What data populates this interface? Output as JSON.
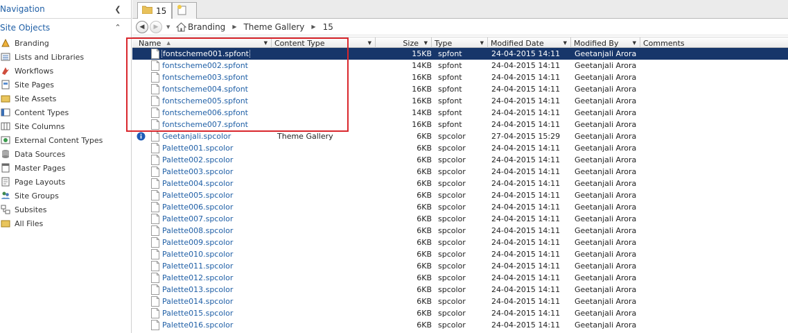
{
  "navigation": {
    "title": "Navigation",
    "site_objects_title": "Site Objects",
    "items": [
      {
        "label": "Branding",
        "icon": "branding-icon"
      },
      {
        "label": "Lists and Libraries",
        "icon": "lists-icon"
      },
      {
        "label": "Workflows",
        "icon": "workflows-icon"
      },
      {
        "label": "Site Pages",
        "icon": "site-pages-icon"
      },
      {
        "label": "Site Assets",
        "icon": "site-assets-icon"
      },
      {
        "label": "Content Types",
        "icon": "content-types-icon"
      },
      {
        "label": "Site Columns",
        "icon": "site-columns-icon"
      },
      {
        "label": "External Content Types",
        "icon": "external-content-types-icon"
      },
      {
        "label": "Data Sources",
        "icon": "data-sources-icon"
      },
      {
        "label": "Master Pages",
        "icon": "master-pages-icon"
      },
      {
        "label": "Page Layouts",
        "icon": "page-layouts-icon"
      },
      {
        "label": "Site Groups",
        "icon": "site-groups-icon"
      },
      {
        "label": "Subsites",
        "icon": "subsites-icon"
      },
      {
        "label": "All Files",
        "icon": "all-files-icon"
      }
    ]
  },
  "tabs": {
    "active_label": "15"
  },
  "breadcrumb": [
    "Branding",
    "Theme Gallery",
    "15"
  ],
  "columns": {
    "name": "Name",
    "content_type": "Content Type",
    "size": "Size",
    "type": "Type",
    "modified_date": "Modified Date",
    "modified_by": "Modified By",
    "comments": "Comments"
  },
  "files": [
    {
      "name": "fontscheme001.spfont",
      "content_type": "",
      "size": "15KB",
      "type": "spfont",
      "modified_date": "24-04-2015 14:11",
      "modified_by": "Geetanjali Arora",
      "selected": true
    },
    {
      "name": "fontscheme002.spfont",
      "content_type": "",
      "size": "14KB",
      "type": "spfont",
      "modified_date": "24-04-2015 14:11",
      "modified_by": "Geetanjali Arora"
    },
    {
      "name": "fontscheme003.spfont",
      "content_type": "",
      "size": "16KB",
      "type": "spfont",
      "modified_date": "24-04-2015 14:11",
      "modified_by": "Geetanjali Arora"
    },
    {
      "name": "fontscheme004.spfont",
      "content_type": "",
      "size": "16KB",
      "type": "spfont",
      "modified_date": "24-04-2015 14:11",
      "modified_by": "Geetanjali Arora"
    },
    {
      "name": "fontscheme005.spfont",
      "content_type": "",
      "size": "16KB",
      "type": "spfont",
      "modified_date": "24-04-2015 14:11",
      "modified_by": "Geetanjali Arora"
    },
    {
      "name": "fontscheme006.spfont",
      "content_type": "",
      "size": "14KB",
      "type": "spfont",
      "modified_date": "24-04-2015 14:11",
      "modified_by": "Geetanjali Arora"
    },
    {
      "name": "fontscheme007.spfont",
      "content_type": "",
      "size": "16KB",
      "type": "spfont",
      "modified_date": "24-04-2015 14:11",
      "modified_by": "Geetanjali Arora"
    },
    {
      "name": "Geetanjali.spcolor",
      "content_type": "Theme Gallery",
      "size": "6KB",
      "type": "spcolor",
      "modified_date": "27-04-2015 15:29",
      "modified_by": "Geetanjali Arora",
      "info": true
    },
    {
      "name": "Palette001.spcolor",
      "content_type": "",
      "size": "6KB",
      "type": "spcolor",
      "modified_date": "24-04-2015 14:11",
      "modified_by": "Geetanjali Arora"
    },
    {
      "name": "Palette002.spcolor",
      "content_type": "",
      "size": "6KB",
      "type": "spcolor",
      "modified_date": "24-04-2015 14:11",
      "modified_by": "Geetanjali Arora"
    },
    {
      "name": "Palette003.spcolor",
      "content_type": "",
      "size": "6KB",
      "type": "spcolor",
      "modified_date": "24-04-2015 14:11",
      "modified_by": "Geetanjali Arora"
    },
    {
      "name": "Palette004.spcolor",
      "content_type": "",
      "size": "6KB",
      "type": "spcolor",
      "modified_date": "24-04-2015 14:11",
      "modified_by": "Geetanjali Arora"
    },
    {
      "name": "Palette005.spcolor",
      "content_type": "",
      "size": "6KB",
      "type": "spcolor",
      "modified_date": "24-04-2015 14:11",
      "modified_by": "Geetanjali Arora"
    },
    {
      "name": "Palette006.spcolor",
      "content_type": "",
      "size": "6KB",
      "type": "spcolor",
      "modified_date": "24-04-2015 14:11",
      "modified_by": "Geetanjali Arora"
    },
    {
      "name": "Palette007.spcolor",
      "content_type": "",
      "size": "6KB",
      "type": "spcolor",
      "modified_date": "24-04-2015 14:11",
      "modified_by": "Geetanjali Arora"
    },
    {
      "name": "Palette008.spcolor",
      "content_type": "",
      "size": "6KB",
      "type": "spcolor",
      "modified_date": "24-04-2015 14:11",
      "modified_by": "Geetanjali Arora"
    },
    {
      "name": "Palette009.spcolor",
      "content_type": "",
      "size": "6KB",
      "type": "spcolor",
      "modified_date": "24-04-2015 14:11",
      "modified_by": "Geetanjali Arora"
    },
    {
      "name": "Palette010.spcolor",
      "content_type": "",
      "size": "6KB",
      "type": "spcolor",
      "modified_date": "24-04-2015 14:11",
      "modified_by": "Geetanjali Arora"
    },
    {
      "name": "Palette011.spcolor",
      "content_type": "",
      "size": "6KB",
      "type": "spcolor",
      "modified_date": "24-04-2015 14:11",
      "modified_by": "Geetanjali Arora"
    },
    {
      "name": "Palette012.spcolor",
      "content_type": "",
      "size": "6KB",
      "type": "spcolor",
      "modified_date": "24-04-2015 14:11",
      "modified_by": "Geetanjali Arora"
    },
    {
      "name": "Palette013.spcolor",
      "content_type": "",
      "size": "6KB",
      "type": "spcolor",
      "modified_date": "24-04-2015 14:11",
      "modified_by": "Geetanjali Arora"
    },
    {
      "name": "Palette014.spcolor",
      "content_type": "",
      "size": "6KB",
      "type": "spcolor",
      "modified_date": "24-04-2015 14:11",
      "modified_by": "Geetanjali Arora"
    },
    {
      "name": "Palette015.spcolor",
      "content_type": "",
      "size": "6KB",
      "type": "spcolor",
      "modified_date": "24-04-2015 14:11",
      "modified_by": "Geetanjali Arora"
    },
    {
      "name": "Palette016.spcolor",
      "content_type": "",
      "size": "6KB",
      "type": "spcolor",
      "modified_date": "24-04-2015 14:11",
      "modified_by": "Geetanjali Arora"
    }
  ],
  "colors": {
    "link": "#1f5fa6",
    "selection": "#17366a",
    "highlight_box": "#d9262c"
  }
}
